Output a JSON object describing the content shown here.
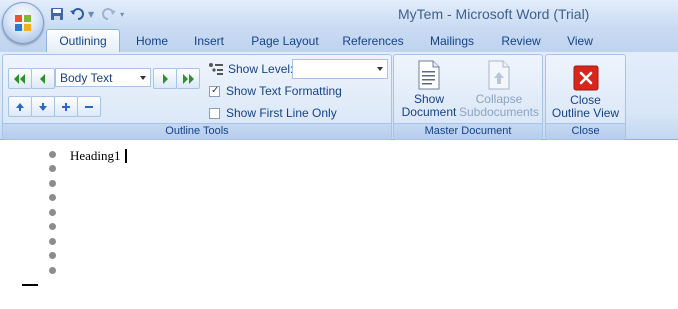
{
  "app": {
    "window_title": "MyTem - Microsoft Word (Trial)"
  },
  "quick_access": {
    "items": [
      "save-icon",
      "undo-icon",
      "redo-icon",
      "customize-icon"
    ]
  },
  "tabs": [
    {
      "label": "Outlining",
      "active": true
    },
    {
      "label": "Home"
    },
    {
      "label": "Insert"
    },
    {
      "label": "Page Layout"
    },
    {
      "label": "References"
    },
    {
      "label": "Mailings"
    },
    {
      "label": "Review"
    },
    {
      "label": "View"
    }
  ],
  "ribbon": {
    "outline_tools": {
      "label": "Outline Tools",
      "level_value": "Body Text",
      "show_level_label": "Show Level:",
      "show_level_value": "",
      "show_text_formatting": {
        "label": "Show Text Formatting",
        "checked": true
      },
      "show_first_line_only": {
        "label": "Show First Line Only",
        "checked": false
      }
    },
    "master_document": {
      "label": "Master Document",
      "show_document": {
        "line1": "Show",
        "line2": "Document"
      },
      "collapse_subdocuments": {
        "line1": "Collapse",
        "line2": "Subdocuments",
        "enabled": false
      }
    },
    "close": {
      "label": "Close",
      "close_outline_view": {
        "line1": "Close",
        "line2": "Outline View"
      }
    }
  },
  "document": {
    "heading": "Heading1",
    "bullet_count": 9
  },
  "colors": {
    "ribbon_text": "#15428b",
    "close_button_red": "#d9261c",
    "bullet_gray": "#8c8c8c"
  }
}
